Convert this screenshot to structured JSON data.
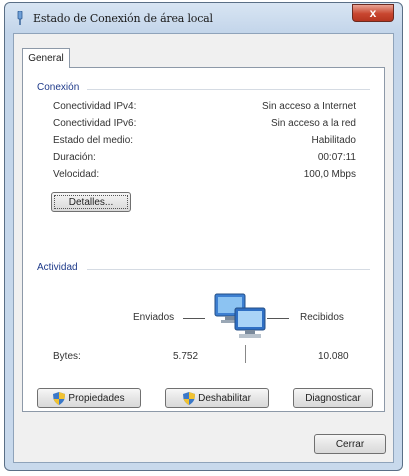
{
  "window": {
    "title": "Estado de Conexión de área local",
    "close_glyph": "x"
  },
  "tabs": [
    {
      "label": "General"
    }
  ],
  "conexion": {
    "heading": "Conexión",
    "rows": [
      {
        "label": "Conectividad IPv4:",
        "value": "Sin acceso a Internet"
      },
      {
        "label": "Conectividad IPv6:",
        "value": "Sin acceso a la red"
      },
      {
        "label": "Estado del medio:",
        "value": "Habilitado"
      },
      {
        "label": "Duración:",
        "value": "00:07:11"
      },
      {
        "label": "Velocidad:",
        "value": "100,0 Mbps"
      }
    ],
    "details_button": "Detalles..."
  },
  "actividad": {
    "heading": "Actividad",
    "sent_label": "Enviados",
    "received_label": "Recibidos",
    "bytes_label": "Bytes:",
    "bytes_sent": "5.752",
    "bytes_received": "10.080"
  },
  "buttons": {
    "properties": "Propiedades",
    "disable": "Deshabilitar",
    "diagnose": "Diagnosticar",
    "close": "Cerrar"
  },
  "icons": {
    "title": "network-adapter-icon",
    "shield": "uac-shield-icon",
    "activity": "network-computers-icon"
  }
}
